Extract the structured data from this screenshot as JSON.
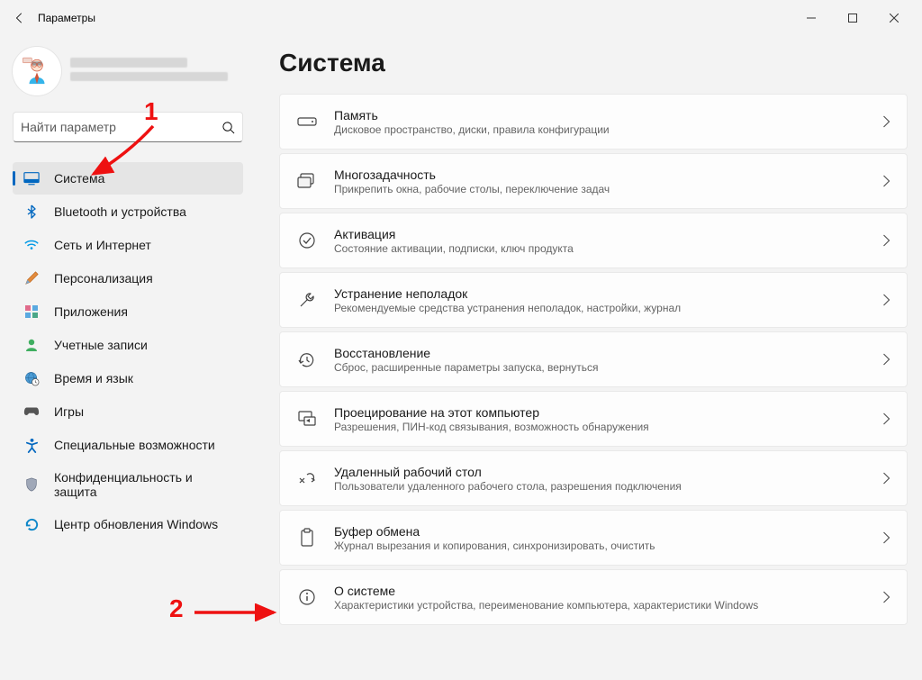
{
  "window": {
    "title": "Параметры"
  },
  "account": {
    "name_redacted": true
  },
  "search": {
    "placeholder": "Найти параметр"
  },
  "nav": [
    {
      "key": "system",
      "label": "Система",
      "active": true
    },
    {
      "key": "bluetooth",
      "label": "Bluetooth и устройства"
    },
    {
      "key": "network",
      "label": "Сеть и Интернет"
    },
    {
      "key": "personalization",
      "label": "Персонализация"
    },
    {
      "key": "apps",
      "label": "Приложения"
    },
    {
      "key": "accounts",
      "label": "Учетные записи"
    },
    {
      "key": "time",
      "label": "Время и язык"
    },
    {
      "key": "gaming",
      "label": "Игры"
    },
    {
      "key": "accessibility",
      "label": "Специальные возможности"
    },
    {
      "key": "privacy",
      "label": "Конфиденциальность и защита"
    },
    {
      "key": "update",
      "label": "Центр обновления Windows"
    }
  ],
  "page": {
    "title": "Система"
  },
  "items": [
    {
      "key": "storage",
      "title": "Память",
      "sub": "Дисковое пространство, диски, правила конфигурации"
    },
    {
      "key": "multitask",
      "title": "Многозадачность",
      "sub": "Прикрепить окна, рабочие столы, переключение задач"
    },
    {
      "key": "activation",
      "title": "Активация",
      "sub": "Состояние активации, подписки, ключ продукта"
    },
    {
      "key": "troubleshoot",
      "title": "Устранение неполадок",
      "sub": "Рекомендуемые средства устранения неполадок, настройки, журнал"
    },
    {
      "key": "recovery",
      "title": "Восстановление",
      "sub": "Сброс, расширенные параметры запуска, вернуться"
    },
    {
      "key": "projecting",
      "title": "Проецирование на этот компьютер",
      "sub": "Разрешения, ПИН-код связывания, возможность обнаружения"
    },
    {
      "key": "remote",
      "title": "Удаленный рабочий стол",
      "sub": "Пользователи удаленного рабочего стола, разрешения подключения"
    },
    {
      "key": "clipboard",
      "title": "Буфер обмена",
      "sub": "Журнал вырезания и копирования, синхронизировать, очистить"
    },
    {
      "key": "about",
      "title": "О системе",
      "sub": "Характеристики устройства, переименование компьютера, характеристики Windows"
    }
  ],
  "annotations": {
    "one": "1",
    "two": "2"
  }
}
